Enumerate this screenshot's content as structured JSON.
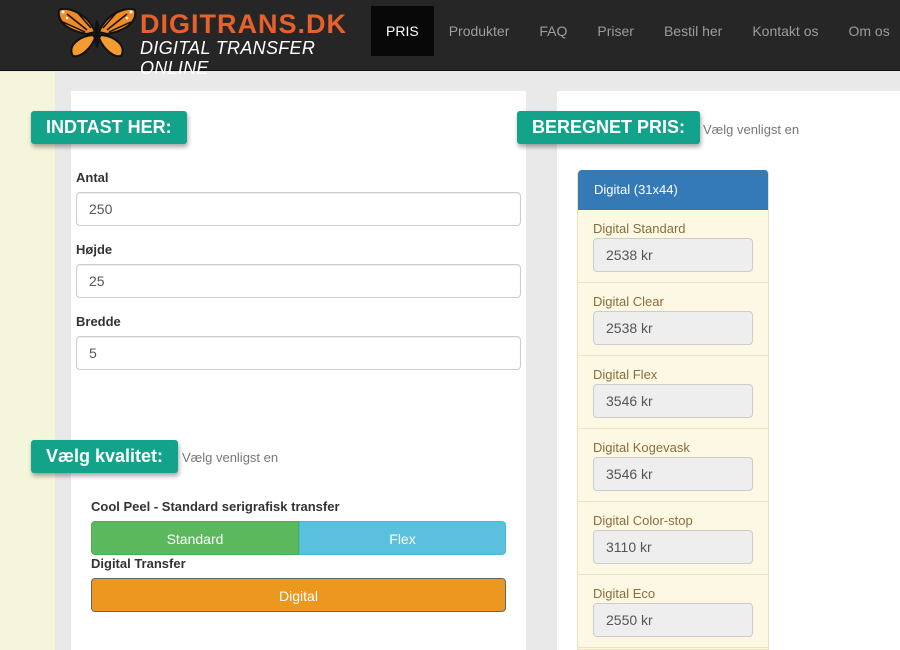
{
  "brand": {
    "name": "DIGITRANS.DK",
    "tagline": "DIGITAL TRANSFER ONLINE"
  },
  "nav": {
    "items": [
      {
        "label": "PRIS",
        "active": true
      },
      {
        "label": "Produkter"
      },
      {
        "label": "FAQ"
      },
      {
        "label": "Priser"
      },
      {
        "label": "Bestil her"
      },
      {
        "label": "Kontakt os"
      },
      {
        "label": "Om os"
      }
    ]
  },
  "input_section": {
    "badge": "INDTAST HER:",
    "fields": [
      {
        "label": "Antal",
        "value": "250"
      },
      {
        "label": "Højde",
        "value": "25"
      },
      {
        "label": "Bredde",
        "value": "5"
      }
    ]
  },
  "quality_section": {
    "badge": "Vælg kvalitet:",
    "hint": "Vælg venligst en",
    "group1_label": "Cool Peel - Standard serigrafisk transfer",
    "standard_label": "Standard",
    "flex_label": "Flex",
    "group2_label": "Digital Transfer",
    "digital_label": "Digital"
  },
  "price_section": {
    "badge": "BEREGNET PRIS:",
    "hint": "Vælg venligst en",
    "header": "Digital (31x44)",
    "items": [
      {
        "name": "Digital Standard",
        "price": "2538 kr"
      },
      {
        "name": "Digital Clear",
        "price": "2538 kr"
      },
      {
        "name": "Digital Flex",
        "price": "3546 kr"
      },
      {
        "name": "Digital Kogevask",
        "price": "3546 kr"
      },
      {
        "name": "Digital Color-stop",
        "price": "3110 kr"
      },
      {
        "name": "Digital Eco",
        "price": "2550 kr"
      }
    ]
  },
  "colors": {
    "navbar": "#262626",
    "badge": "#12a38a",
    "standard": "#5cb85c",
    "flex": "#5bc0de",
    "digital": "#ec971f",
    "price_header": "#337ab7",
    "price_bg": "#fcf8e3",
    "logo_orange": "#e8612c"
  },
  "icons": {
    "logo": "butterfly-icon"
  }
}
